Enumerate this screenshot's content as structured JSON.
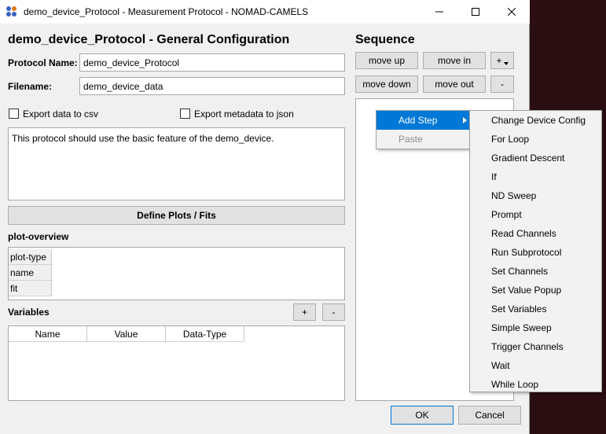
{
  "window": {
    "title": "demo_device_Protocol - Measurement Protocol - NOMAD-CAMELS"
  },
  "config": {
    "heading": "demo_device_Protocol - General Configuration",
    "protocol_name_label": "Protocol Name:",
    "protocol_name_value": "demo_device_Protocol",
    "filename_label": "Filename:",
    "filename_value": "demo_device_data",
    "export_csv_label": "Export data to csv",
    "export_json_label": "Export metadata to json",
    "description": "This protocol should use the basic feature of the demo_device.",
    "define_plots_label": "Define Plots / Fits",
    "plot_overview_label": "plot-overview",
    "plot_rows": [
      "plot-type",
      "name",
      "fit"
    ],
    "variables_label": "Variables",
    "variables_add": "+",
    "variables_remove": "-",
    "variable_columns": [
      "Name",
      "Value",
      "Data-Type"
    ]
  },
  "sequence": {
    "heading": "Sequence",
    "move_up": "move up",
    "move_in": "move in",
    "add": "+",
    "move_down": "move down",
    "move_out": "move out",
    "remove": "-"
  },
  "context_menu": {
    "items": [
      "Add Step",
      "Paste"
    ]
  },
  "submenu": {
    "items": [
      "Change Device Config",
      "For Loop",
      "Gradient Descent",
      "If",
      "ND Sweep",
      "Prompt",
      "Read Channels",
      "Run Subprotocol",
      "Set Channels",
      "Set Value Popup",
      "Set Variables",
      "Simple Sweep",
      "Trigger Channels",
      "Wait",
      "While Loop"
    ]
  },
  "footer": {
    "ok": "OK",
    "cancel": "Cancel"
  },
  "colors": {
    "accent": "#0078d7",
    "window_bg": "#f0f0f0"
  }
}
